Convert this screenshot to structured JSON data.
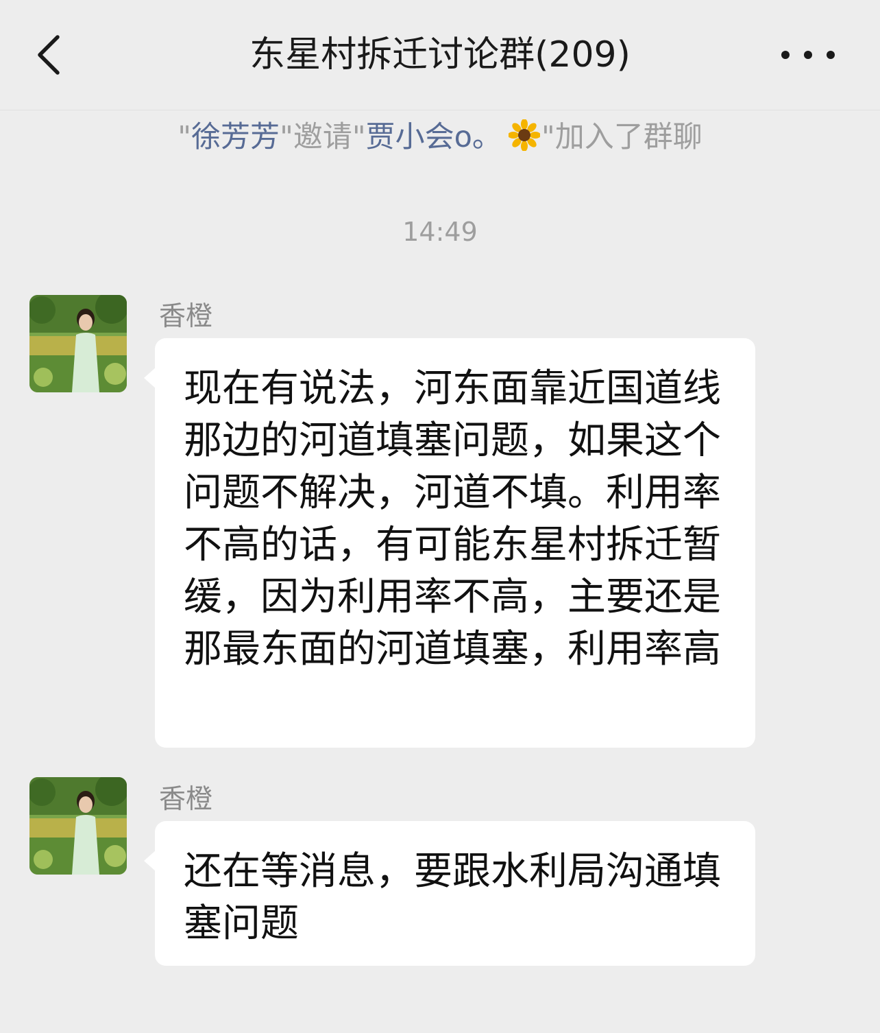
{
  "header": {
    "back_icon": "chevron-left-icon",
    "title": "东星村拆迁讨论群(209)",
    "more_icon": "more-dots-icon"
  },
  "system_message": {
    "quote1": "\"",
    "inviter": "徐芳芳",
    "quote2": "\"",
    "verb": "邀请",
    "quote3": "\"",
    "invitee": "贾小会o。",
    "invitee_emoji": "sunflower-icon",
    "quote4": "\"",
    "suffix": "加入了群聊"
  },
  "timestamp": "14:49",
  "messages": [
    {
      "sender": "香橙",
      "text": "现在有说法，河东面靠近国道线那边的河道填塞问题，如果这个问题不解决，河道不填。利用率不高的话，有可能东星村拆迁暂缓，因为利用率不高，主要还是那最东面的河道填塞，利用率高"
    },
    {
      "sender": "香橙",
      "text": "还在等消息，要跟水利局沟通填塞问题"
    }
  ],
  "colors": {
    "background": "#ededed",
    "bubble": "#ffffff",
    "name_link": "#576b95",
    "muted_text": "#9e9e9e"
  }
}
